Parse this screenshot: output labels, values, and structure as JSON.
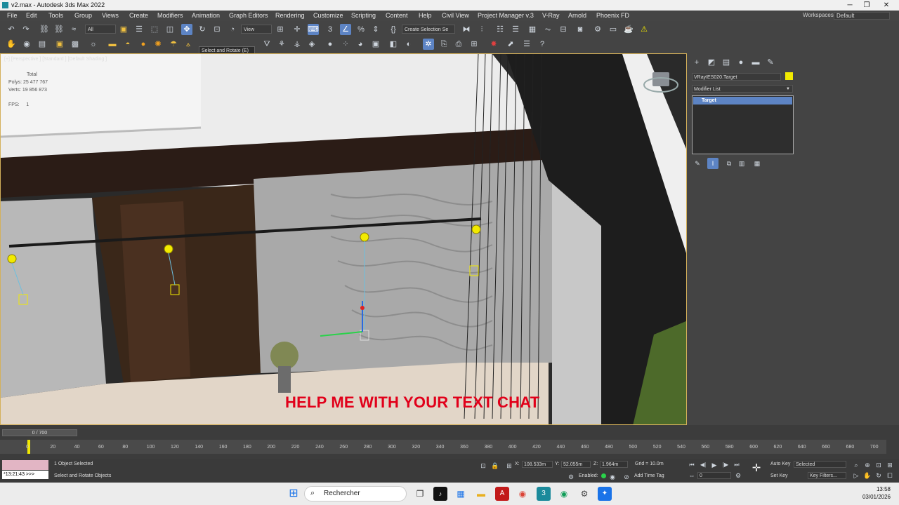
{
  "window": {
    "title": "v2.max - Autodesk 3ds Max 2022",
    "minimize": "─",
    "maximize": "❐",
    "close": "✕"
  },
  "menu": [
    "File",
    "Edit",
    "Tools",
    "Group",
    "Views",
    "Create",
    "Modifiers",
    "Animation",
    "Graph Editors",
    "Rendering",
    "Customize",
    "Scripting",
    "Content",
    "Help",
    "Civil View",
    "Project Manager v.3",
    "V-Ray",
    "Arnold",
    "Phoenix FD"
  ],
  "workspaces": {
    "label": "Workspaces:",
    "value": "Default"
  },
  "toolbar": {
    "filter_value": "All",
    "ref_coord_value": "View",
    "named_selection_placeholder": "Create Selection Se",
    "tooltip": "Select and Rotate   (E)"
  },
  "viewport": {
    "label": "[+] [Perspective ] [Standard ] [Default Shading ]",
    "stats_header": "Total",
    "polys_label": "Polys:",
    "polys_value": "25 477 767",
    "verts_label": "Verts:",
    "verts_value": "19 856 873",
    "fps_label": "FPS:",
    "fps_value": "1",
    "overlay_text": "HELP ME WITH YOUR TEXT CHAT"
  },
  "command_panel": {
    "object_name": "VRayIES020.Target",
    "object_color": "#f2ea00",
    "modifier_list": "Modifier List",
    "stack_item": "Target"
  },
  "timeline": {
    "frame_display": "0 / 700",
    "ticks": [
      "0",
      "20",
      "40",
      "60",
      "80",
      "100",
      "120",
      "140",
      "160",
      "180",
      "200",
      "220",
      "240",
      "260",
      "280",
      "300",
      "320",
      "340",
      "360",
      "380",
      "400",
      "420",
      "440",
      "460",
      "480",
      "500",
      "520",
      "540",
      "560",
      "580",
      "600",
      "620",
      "640",
      "660",
      "680",
      "700"
    ]
  },
  "status": {
    "maxscript_time": "*13:21:43 >>>",
    "selection": "1 Object Selected",
    "prompt": "Select and Rotate Objects",
    "x_label": "X:",
    "x_value": "108.533m",
    "y_label": "Y:",
    "y_value": "52.055m",
    "z_label": "Z:",
    "z_value": "1.964m",
    "grid": "Grid = 10.0m",
    "enabled": "Enabled:",
    "add_time_tag": "Add Time Tag",
    "auto_key": "Auto Key",
    "key_mode": "Selected",
    "set_key": "Set Key",
    "key_filters": "Key Filters...",
    "frame": "0"
  },
  "taskbar": {
    "search": "Rechercher",
    "time": "13:58",
    "date": "03/01/2026"
  }
}
